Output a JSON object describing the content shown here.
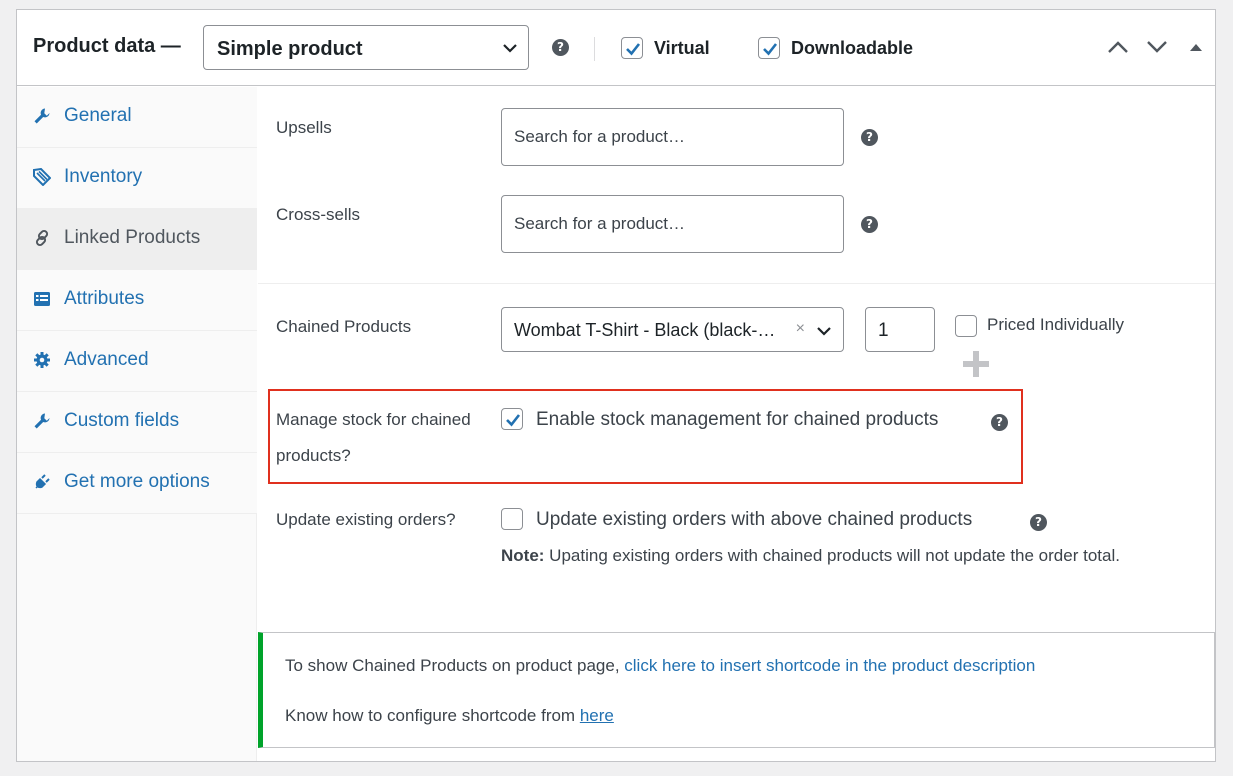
{
  "header": {
    "title": "Product data —",
    "product_type": "Simple product",
    "virtual_label": "Virtual",
    "virtual_checked": true,
    "downloadable_label": "Downloadable",
    "downloadable_checked": true
  },
  "sidebar": {
    "items": [
      {
        "label": "General",
        "icon": "wrench-icon",
        "active": false
      },
      {
        "label": "Inventory",
        "icon": "tag-icon",
        "active": false
      },
      {
        "label": "Linked Products",
        "icon": "link-icon",
        "active": true
      },
      {
        "label": "Attributes",
        "icon": "list-icon",
        "active": false
      },
      {
        "label": "Advanced",
        "icon": "gear-icon",
        "active": false
      },
      {
        "label": "Custom fields",
        "icon": "wrench-icon",
        "active": false
      },
      {
        "label": "Get more options",
        "icon": "plugin-icon",
        "active": false
      }
    ]
  },
  "linked": {
    "upsells_label": "Upsells",
    "upsells_placeholder": "Search for a product…",
    "crosssells_label": "Cross-sells",
    "crosssells_placeholder": "Search for a product…"
  },
  "chained": {
    "label": "Chained Products",
    "selected_product": "Wombat T-Shirt - Black (black-…",
    "quantity": "1",
    "priced_individually_label": "Priced Individually",
    "priced_individually_checked": false,
    "add_symbol": "+",
    "manage_stock_label_line1": "Manage stock for chained",
    "manage_stock_label_line2": "products?",
    "manage_stock_checked": true,
    "manage_stock_text": "Enable stock management for chained products",
    "update_orders_label": "Update existing orders?",
    "update_orders_checked": false,
    "update_orders_text": "Update existing orders with above chained products",
    "note_bold": "Note:",
    "note_text": " Upating existing orders with chained products will not update the order total."
  },
  "notice": {
    "line1_text": "To show Chained Products on product page, ",
    "line1_link": "click here to insert shortcode in the product description",
    "line2_text": "Know how to configure shortcode from ",
    "line2_link": "here"
  },
  "colors": {
    "accent": "#2271b1",
    "highlight_border": "#e0301e",
    "notice_border": "#00a32a"
  }
}
